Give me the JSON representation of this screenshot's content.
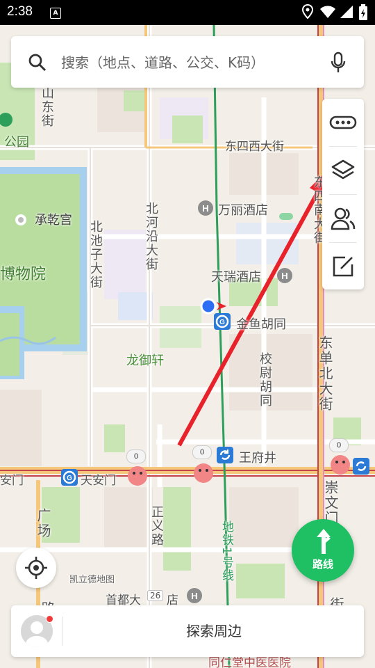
{
  "status_bar": {
    "time": "2:38",
    "app_icon": "A"
  },
  "search": {
    "placeholder": "搜索（地点、道路、公交、K码）"
  },
  "map_labels": {
    "dongsi_xi": "东四西大街",
    "wanli_hotel": "万丽酒店",
    "tianrui_hotel": "天瑞酒店",
    "jinyu_hutong": "金鱼胡同",
    "longyuxuan": "龙御轩",
    "wangfujing": "王府井",
    "tiananmen": "天安门",
    "tiananmen_left": "安门",
    "chengqian_palace": "承乾宫",
    "palace_museum": "博物院",
    "park": "公园",
    "kailide": "凯立德地图",
    "shoudu": "首都大",
    "shoudu_suffix": "店",
    "hospital": "同仁堂中医医院",
    "bei_chizi": "北池子大街",
    "bei_heyan": "北河沿大街",
    "jiao_wei": "校尉胡同",
    "dongsi_nan": "东四南大街",
    "dongdan_bei": "东单北大街",
    "chongwen": "崇文门",
    "zhengyi": "正义路",
    "guangchang": "广场",
    "shan_dong": "山东街",
    "metro_line1": "地铁1号线",
    "metro_line1_top": "地",
    "road_num": "26",
    "road_left": "路",
    "road_right": "街"
  },
  "badges": {
    "b1": "0",
    "b2": "0",
    "b3": "0"
  },
  "toolbar": {
    "items": [
      "more-icon",
      "layers-icon",
      "friends-icon",
      "feedback-icon"
    ]
  },
  "route_button": {
    "label": "路线"
  },
  "bottom": {
    "explore_label": "探索周边"
  },
  "colors": {
    "route_green": "#1fbf64",
    "arrow_red": "#e8222a",
    "park_green": "#b9dd9f",
    "water_blue": "#a7d0ee",
    "metro_green": "#2e9e5b"
  }
}
